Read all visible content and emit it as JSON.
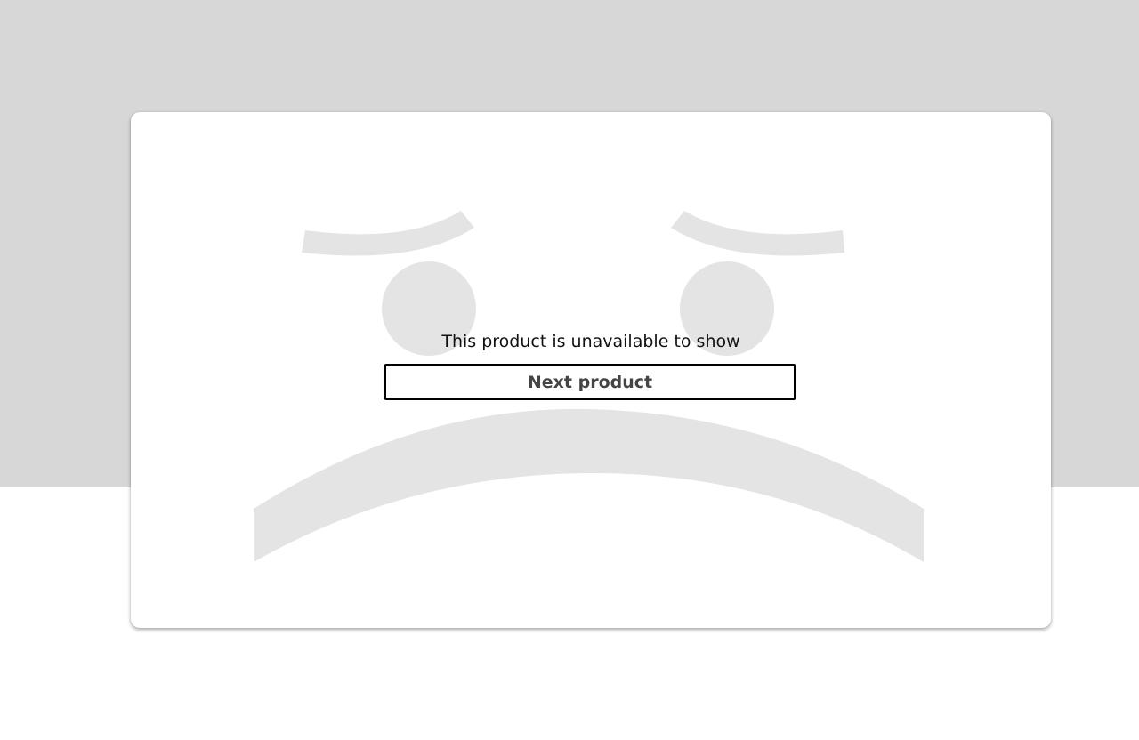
{
  "modal": {
    "message": "This product is unavailable to show",
    "next_button_label": "Next product"
  },
  "illustration": {
    "name": "sad-face-icon",
    "color": "#e4e4e4"
  },
  "colors": {
    "backdrop": "#d7d7d7",
    "card_background": "#ffffff",
    "button_border": "#000000",
    "button_text": "#444444",
    "message_text": "#111111"
  }
}
